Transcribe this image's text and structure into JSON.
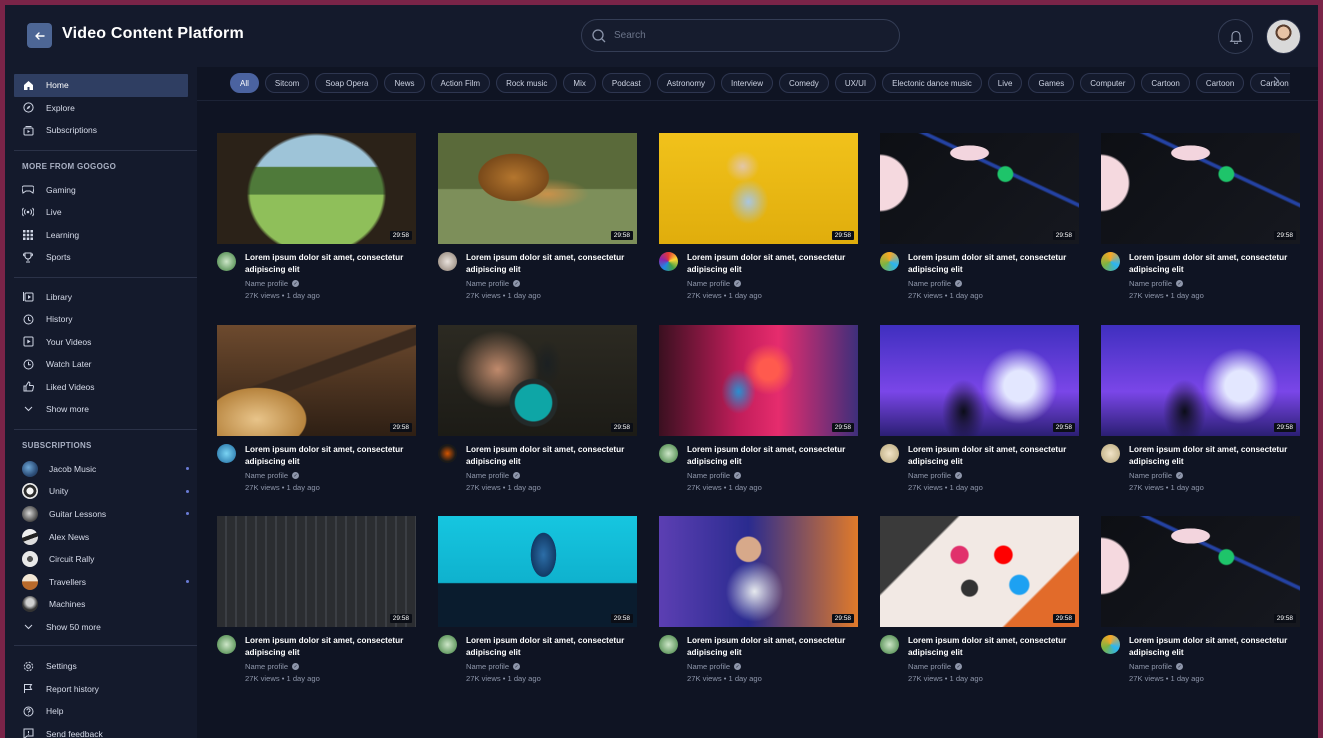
{
  "app": {
    "title": "Video Content Platform",
    "accent": "#4b63a0",
    "background": "#0f1423",
    "panel": "#141a2c"
  },
  "header": {
    "search_placeholder": "Search",
    "back_icon": "arrow-left-icon",
    "bell_icon": "bell-icon"
  },
  "sidebar": {
    "main": [
      {
        "label": "Home",
        "icon": "home-icon"
      },
      {
        "label": "Explore",
        "icon": "compass-icon"
      },
      {
        "label": "Subscriptions",
        "icon": "subscriptions-icon"
      }
    ],
    "more_heading": "MORE FROM GOGOGO",
    "more": [
      {
        "label": "Gaming",
        "icon": "gamepad-icon"
      },
      {
        "label": "Live",
        "icon": "broadcast-icon"
      },
      {
        "label": "Learning",
        "icon": "grid-icon"
      },
      {
        "label": "Sports",
        "icon": "trophy-icon"
      }
    ],
    "library": [
      {
        "label": "Library",
        "icon": "library-icon"
      },
      {
        "label": "History",
        "icon": "history-icon"
      },
      {
        "label": "Your Videos",
        "icon": "play-square-icon"
      },
      {
        "label": "Watch Later",
        "icon": "clock-icon"
      },
      {
        "label": "Liked Videos",
        "icon": "thumbs-up-icon"
      },
      {
        "label": "Show more",
        "icon": "chevron-down-icon"
      }
    ],
    "subs_heading": "SUBSCRIPTIONS",
    "subscriptions": [
      {
        "label": "Jacob Music",
        "new": true
      },
      {
        "label": "Unity",
        "new": true
      },
      {
        "label": "Guitar Lessons",
        "new": true
      },
      {
        "label": "Alex News",
        "new": false
      },
      {
        "label": "Circuit Rally",
        "new": false
      },
      {
        "label": "Travellers",
        "new": true
      },
      {
        "label": "Machines",
        "new": false
      }
    ],
    "show_more_subs": "Show 50 more",
    "footer": [
      {
        "label": "Settings",
        "icon": "gear-icon"
      },
      {
        "label": "Report history",
        "icon": "flag-icon"
      },
      {
        "label": "Help",
        "icon": "help-icon"
      },
      {
        "label": "Send feedback",
        "icon": "feedback-icon"
      }
    ]
  },
  "chips": [
    "All",
    "Sitcom",
    "Soap Opera",
    "News",
    "Action Film",
    "Rock music",
    "Mix",
    "Podcast",
    "Astronomy",
    "Interview",
    "Comedy",
    "UX/UI",
    "Electonic dance music",
    "Live",
    "Games",
    "Computer",
    "Cartoon",
    "Cartoon",
    "Cartoon"
  ],
  "video_common": {
    "title": "Lorem ipsum dolor sit amet, consectetur adipiscing elit",
    "channel": "Name profile",
    "stats": "27K views • 1 day ago",
    "duration": "29:58"
  },
  "videos": [
    {
      "scene": "forest-window"
    },
    {
      "scene": "lion"
    },
    {
      "scene": "dancer-yellow"
    },
    {
      "scene": "music-app"
    },
    {
      "scene": "music-app"
    },
    {
      "scene": "guitar"
    },
    {
      "scene": "headphones"
    },
    {
      "scene": "singer-studio"
    },
    {
      "scene": "concert"
    },
    {
      "scene": "concert"
    },
    {
      "scene": "circuit-board"
    },
    {
      "scene": "blue-hand"
    },
    {
      "scene": "dj-kid"
    },
    {
      "scene": "phone-apps"
    },
    {
      "scene": "music-app"
    }
  ]
}
